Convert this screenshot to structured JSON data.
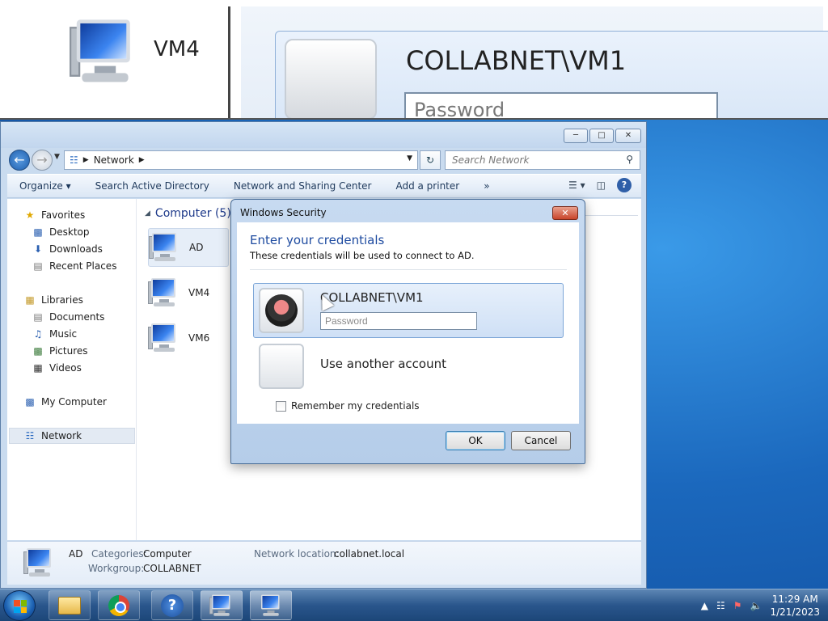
{
  "magnifier": {
    "computer_label": "VM4",
    "user": "COLLABNET\\VM1",
    "password_placeholder": "Password"
  },
  "window": {
    "breadcrumb": "Network",
    "search_placeholder": "Search Network",
    "controls": {
      "minimize": "─",
      "maximize": "□",
      "close": "✕"
    }
  },
  "toolbar": {
    "organize": "Organize ▾",
    "search_ad": "Search Active Directory",
    "network_sharing": "Network and Sharing Center",
    "add_printer": "Add a printer",
    "more": "»"
  },
  "navpane": {
    "favorites": "Favorites",
    "desktop": "Desktop",
    "downloads": "Downloads",
    "recent_places": "Recent Places",
    "libraries": "Libraries",
    "documents": "Documents",
    "music": "Music",
    "pictures": "Pictures",
    "videos": "Videos",
    "my_computer": "My Computer",
    "network": "Network"
  },
  "files": {
    "group_header": "Computer (5)",
    "items": [
      "AD",
      "VM4",
      "VM6"
    ]
  },
  "details": {
    "name": "AD",
    "categories_key": "Categories:",
    "categories_val": "Computer",
    "workgroup_key": "Workgroup:",
    "workgroup_val": "COLLABNET",
    "location_key": "Network location:",
    "location_val": "collabnet.local"
  },
  "dialog": {
    "title": "Windows Security",
    "heading": "Enter your credentials",
    "subtext": "These credentials will be used to connect to AD.",
    "user": "COLLABNET\\VM1",
    "password_placeholder": "Password",
    "other_account": "Use another account",
    "remember": "Remember my credentials",
    "ok": "OK",
    "cancel": "Cancel"
  },
  "taskbar": {
    "time": "11:29 AM",
    "date": "1/21/2023"
  }
}
